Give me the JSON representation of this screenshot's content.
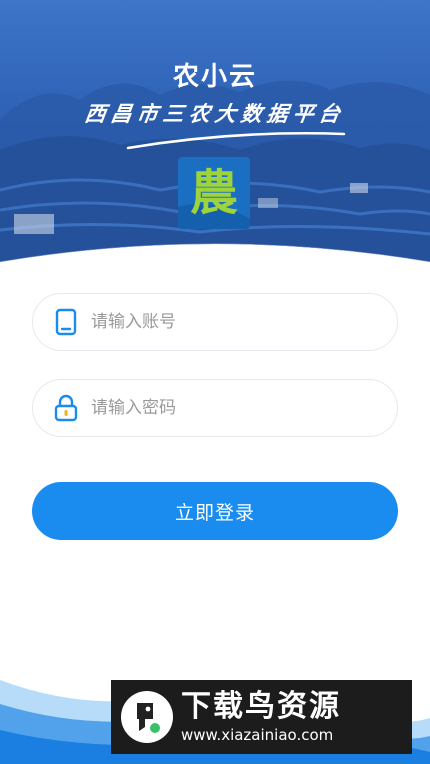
{
  "header": {
    "app_title": "农小云",
    "app_subtitle": "西昌市三农大数据平台",
    "logo_char": "農"
  },
  "form": {
    "account": {
      "placeholder": "请输入账号",
      "value": "",
      "icon": "phone-icon"
    },
    "password": {
      "placeholder": "请输入密码",
      "value": "",
      "icon": "lock-icon"
    },
    "login_label": "立即登录"
  },
  "watermark": {
    "title": "下载鸟资源",
    "url": "www.xiazainiao.com"
  },
  "colors": {
    "primary": "#1a8cf0",
    "header_blue": "#1f5fb8",
    "logo_bg": "#1b6fc2",
    "logo_char": "#9fd33c"
  }
}
